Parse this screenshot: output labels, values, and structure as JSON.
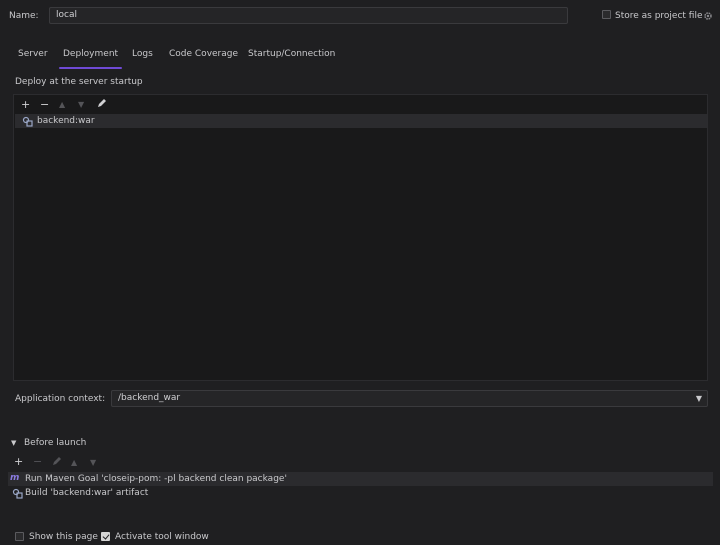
{
  "name_label": "Name:",
  "name_value": "local",
  "store_project_label": "Store as project file",
  "tabs": [
    "Server",
    "Deployment",
    "Logs",
    "Code Coverage",
    "Startup/Connection"
  ],
  "deploy_section_title": "Deploy at the server startup",
  "deploy_items": [
    "backend:war"
  ],
  "app_context_label": "Application context:",
  "app_context_value": "/backend_war",
  "before_launch_title": "Before launch",
  "before_launch_items": [
    "Run Maven Goal 'closeip-pom: -pl backend clean package'",
    "Build 'backend:war' artifact"
  ],
  "show_page_label": "Show this page",
  "activate_tool_label": "Activate tool window",
  "colors": {
    "accent": "#6f4ad6",
    "background": "#1f1f21",
    "panel": "#19191a"
  }
}
